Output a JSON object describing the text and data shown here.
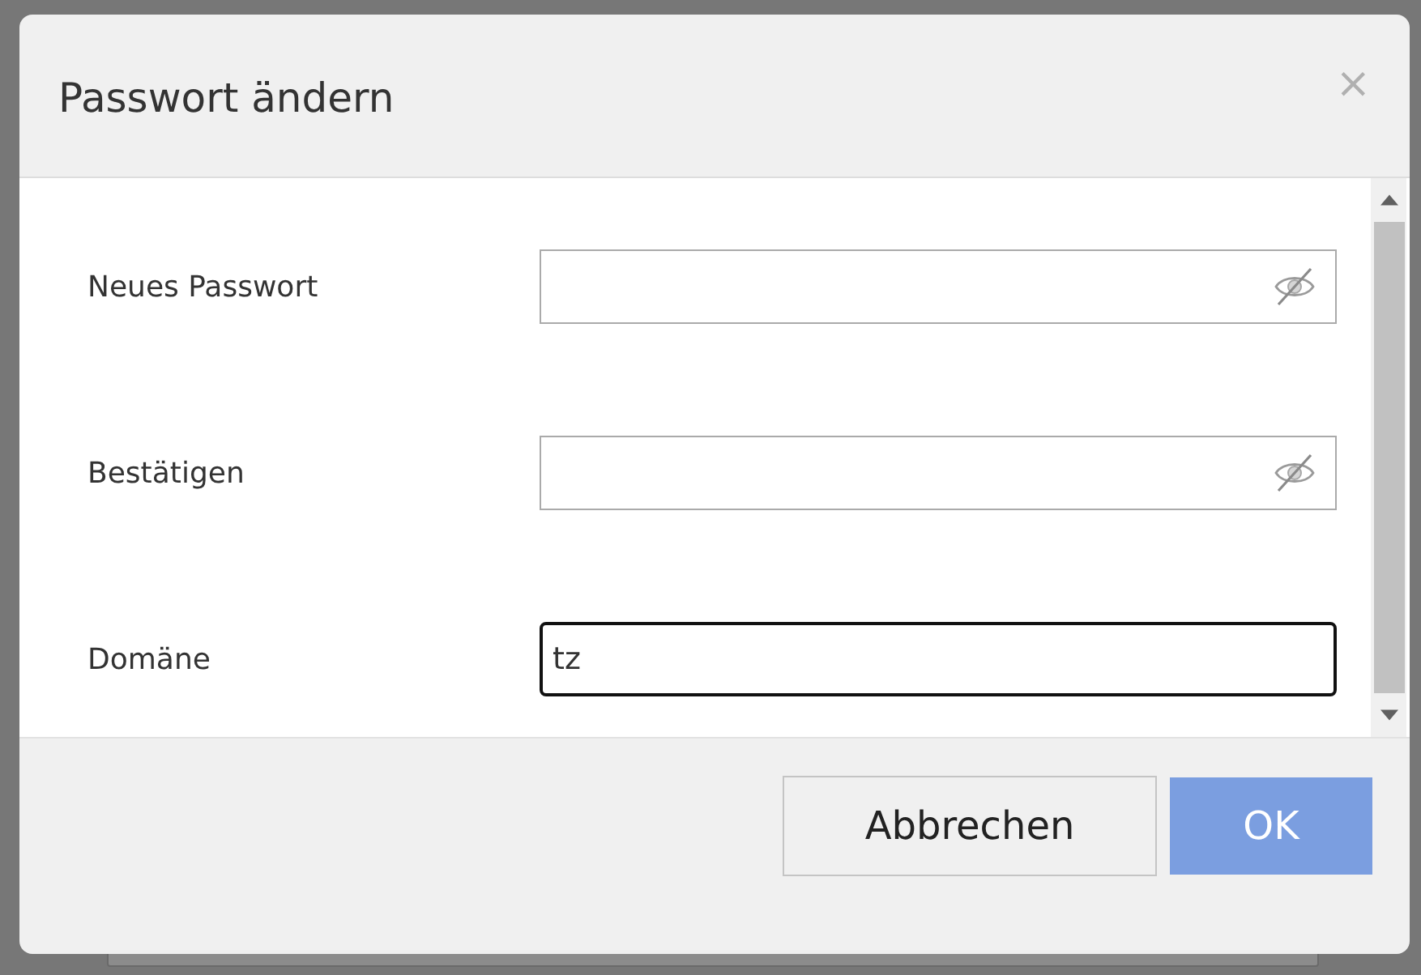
{
  "dialog": {
    "title": "Passwort ändern",
    "close": "×"
  },
  "fields": [
    {
      "label": "Neues Passwort",
      "kind": "password",
      "focused": false
    },
    {
      "label": "Bestätigen",
      "kind": "password",
      "focused": false
    },
    {
      "label": "Domäne",
      "kind": "text",
      "value": "tz",
      "focused": true
    }
  ],
  "buttons": [
    {
      "label": "Abbrechen",
      "kind": "secondary"
    },
    {
      "label": "OK",
      "kind": "primary"
    }
  ]
}
